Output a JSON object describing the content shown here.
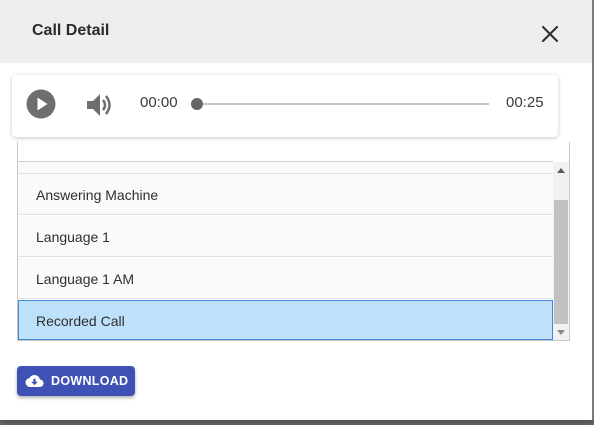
{
  "dialog": {
    "title": "Call Detail"
  },
  "player": {
    "current_time": "00:00",
    "total_time": "00:25",
    "progress": 0
  },
  "list": {
    "items": [
      {
        "label": "Answering Machine",
        "selected": false
      },
      {
        "label": "Language 1",
        "selected": false
      },
      {
        "label": "Language 1 AM",
        "selected": false
      },
      {
        "label": "Recorded Call",
        "selected": true
      }
    ]
  },
  "actions": {
    "download_label": "DOWNLOAD"
  },
  "colors": {
    "accent": "#3f51b5",
    "selection": "#bde0fb",
    "selection_border": "#3f87d6"
  }
}
